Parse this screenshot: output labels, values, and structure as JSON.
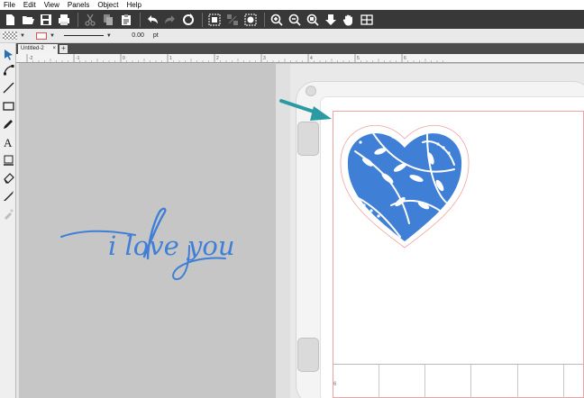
{
  "menu": [
    "File",
    "Edit",
    "View",
    "Panels",
    "Object",
    "Help"
  ],
  "toolbar": {
    "icons": [
      "new-document-icon",
      "open-folder-icon",
      "save-icon",
      "print-icon",
      "cut-icon",
      "copy-icon",
      "paste-icon",
      "undo-icon",
      "redo-icon",
      "rotate-icon",
      "group-icon",
      "ungroup-icon",
      "weld-icon",
      "zoom-in-icon",
      "zoom-out-icon",
      "zoom-fit-icon",
      "move-down-icon",
      "pan-hand-icon",
      "grid-icon"
    ]
  },
  "propbar": {
    "stroke_width": "0.00",
    "unit": "pt",
    "stroke_color": "#e05050"
  },
  "tabs": [
    {
      "label": "Untitled-2",
      "close": "×"
    }
  ],
  "tab_add": "+",
  "ruler": {
    "labels": [
      "-2",
      "-1",
      "0",
      "1",
      "2",
      "3",
      "4",
      "5",
      "6"
    ]
  },
  "tools": [
    "select-arrow-icon",
    "node-edit-icon",
    "line-icon",
    "rectangle-icon",
    "pencil-icon",
    "text-icon",
    "trace-icon",
    "eraser-icon",
    "knife-icon",
    "eyedropper-icon"
  ],
  "canvas": {
    "text": "i love you",
    "text_color": "#3f7fd6",
    "heart_color": "#3f7fd6",
    "arrow_color": "#2a9aa3",
    "mat_number": "6"
  }
}
